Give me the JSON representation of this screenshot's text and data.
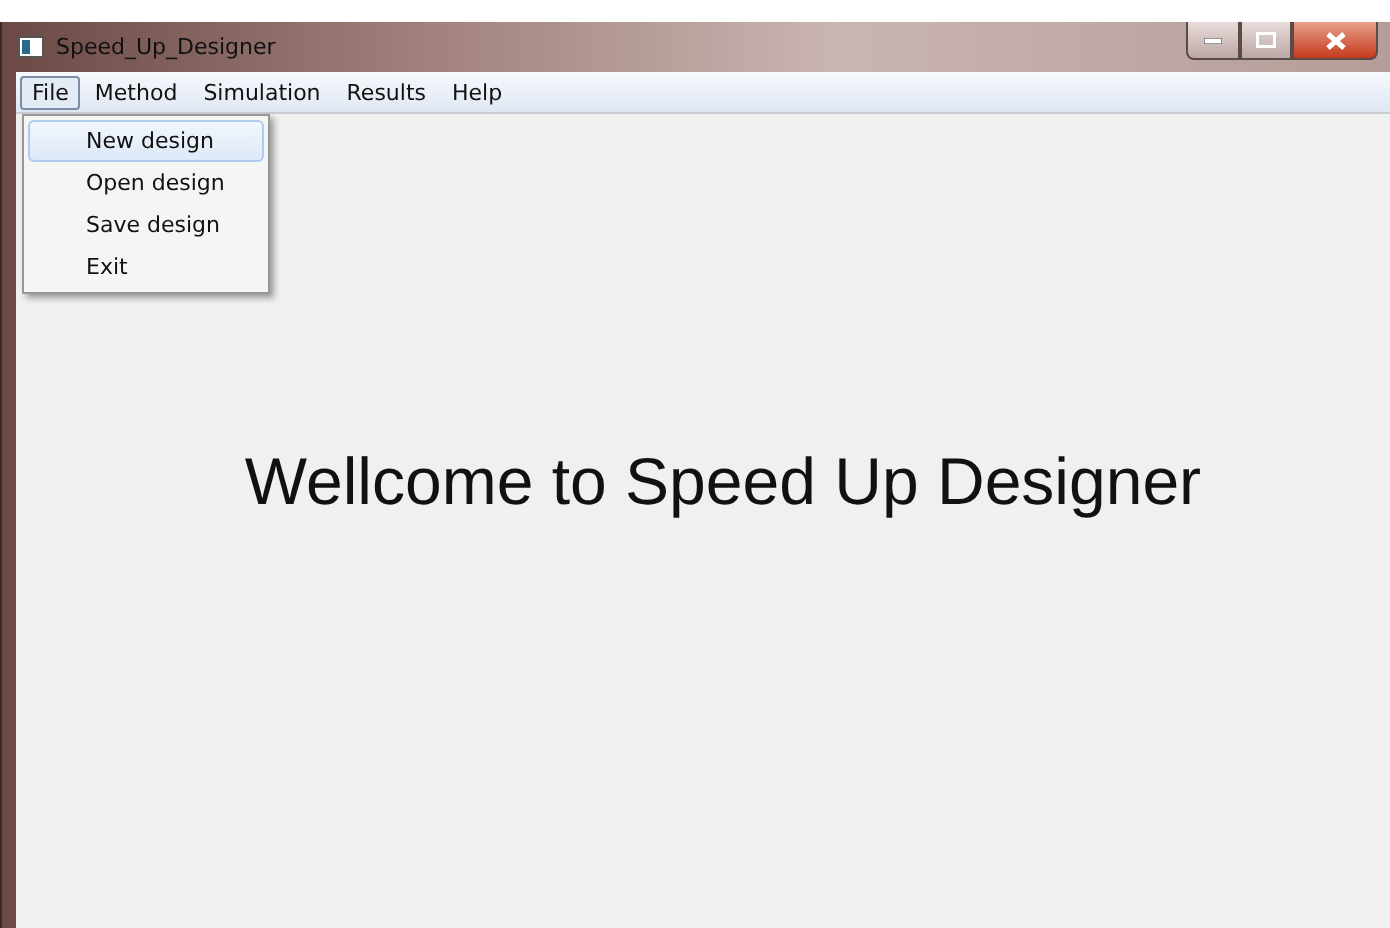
{
  "window": {
    "title": "Speed_Up_Designer"
  },
  "menu_bar": [
    {
      "label": "File",
      "selected": true
    },
    {
      "label": "Method",
      "selected": false
    },
    {
      "label": "Simulation",
      "selected": false
    },
    {
      "label": "Results",
      "selected": false
    },
    {
      "label": "Help",
      "selected": false
    }
  ],
  "file_menu": [
    {
      "label": "New design",
      "selected": true
    },
    {
      "label": "Open design",
      "selected": false
    },
    {
      "label": "Save design",
      "selected": false
    },
    {
      "label": "Exit",
      "selected": false
    }
  ],
  "welcome": "Wellcome to Speed Up Designer"
}
